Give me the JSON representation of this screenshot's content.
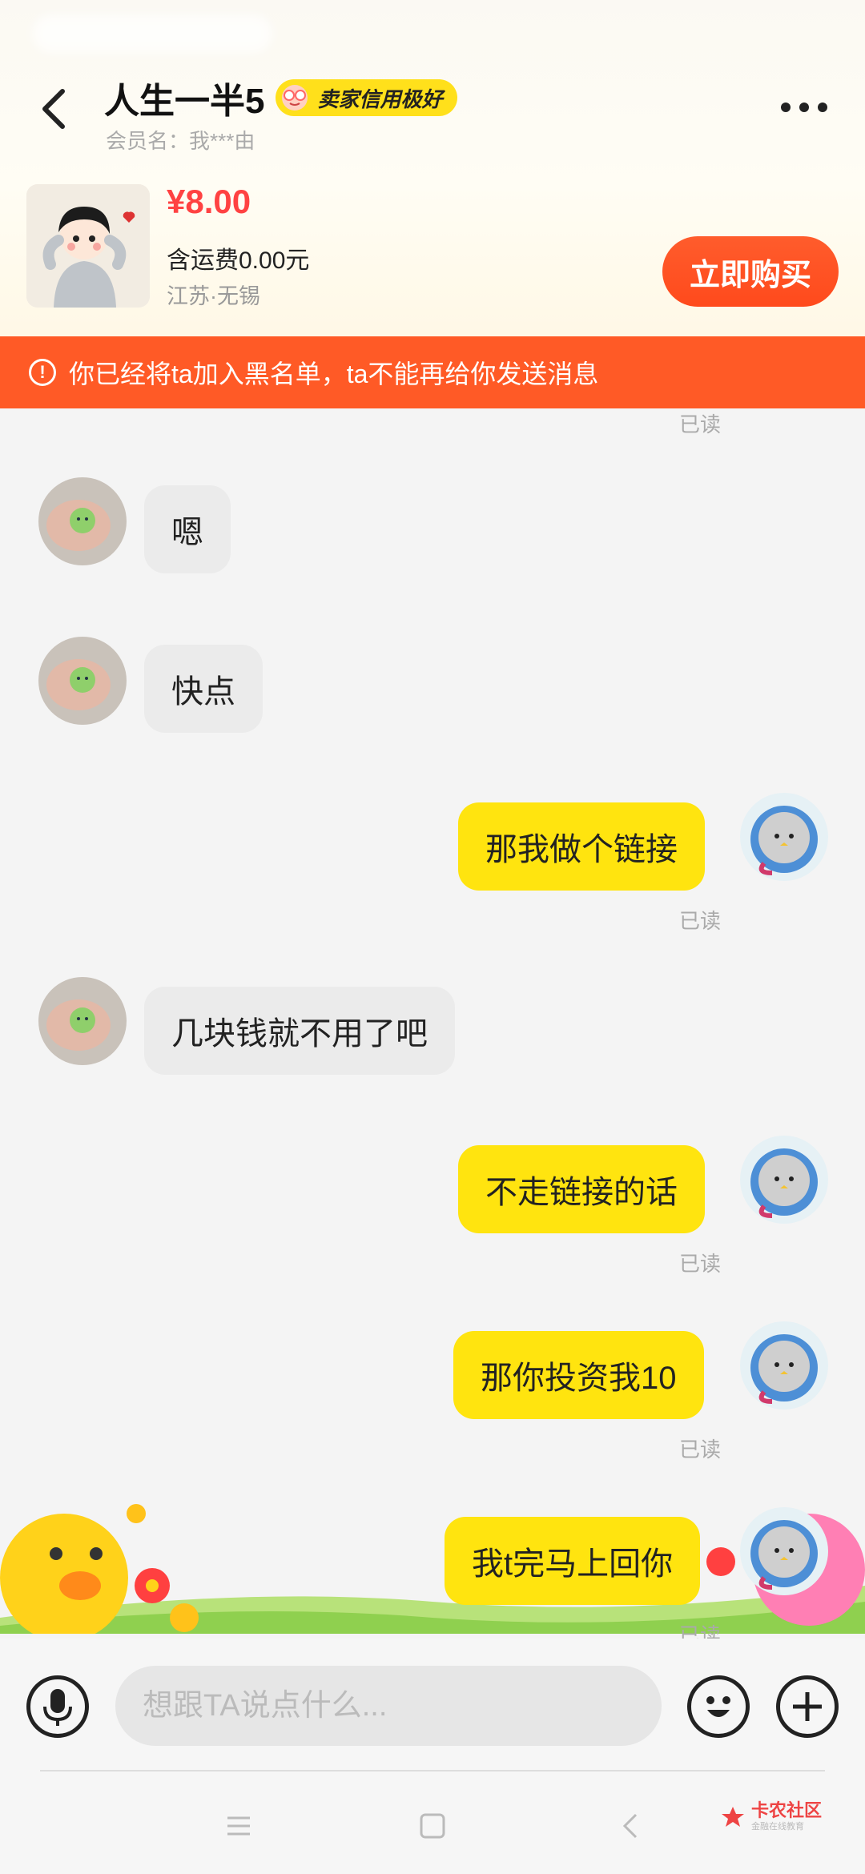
{
  "header": {
    "title": "人生一半5",
    "badge": "卖家信用极好",
    "member": "会员名：我***由"
  },
  "product": {
    "price": "¥8.00",
    "shipping": "含运费0.00元",
    "location": "江苏·无锡",
    "buy_label": "立即购买"
  },
  "warning": {
    "icon": "!",
    "text": "你已经将ta加入黑名单，ta不能再给你发送消息"
  },
  "messages": [
    {
      "side": "in",
      "text": "嗯"
    },
    {
      "side": "in",
      "text": "快点"
    },
    {
      "side": "out",
      "text": "那我做个链接",
      "status": "已读"
    },
    {
      "side": "in",
      "text": "几块钱就不用了吧"
    },
    {
      "side": "out",
      "text": "不走链接的话",
      "status": "已读"
    },
    {
      "side": "out",
      "text": "那你投资我10",
      "status": "已读"
    },
    {
      "side": "out",
      "text": "我t完马上回你",
      "status": "已读"
    }
  ],
  "top_read": "已读",
  "input": {
    "placeholder": "想跟TA说点什么..."
  },
  "watermark": {
    "title": "卡农社区",
    "subtitle": "金融在线教育"
  },
  "colors": {
    "accent_yellow": "#ffe40f",
    "warning_orange": "#ff5a26",
    "price_red": "#ff4242"
  }
}
